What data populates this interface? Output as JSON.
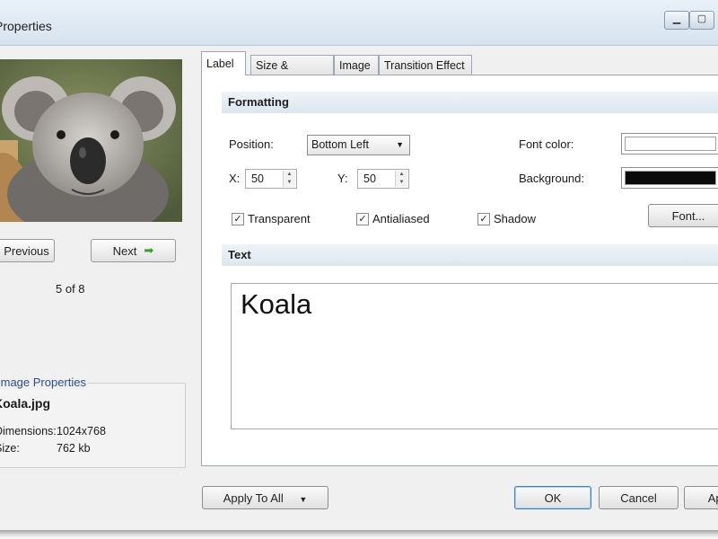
{
  "window": {
    "title": "Properties"
  },
  "preview": {
    "previous_label": "Previous",
    "next_label": "Next",
    "counter": "5 of 8"
  },
  "image_properties": {
    "legend": "Image Properties",
    "filename": "Koala.jpg",
    "rows": [
      {
        "key": "Dimensions:",
        "value": "1024x768"
      },
      {
        "key": "Size:",
        "value": "762 kb"
      }
    ]
  },
  "tabs": [
    {
      "label": "Label",
      "active": true
    },
    {
      "label": "Size & Position",
      "active": false
    },
    {
      "label": "Image",
      "active": false
    },
    {
      "label": "Transition Effect",
      "active": false
    }
  ],
  "formatting": {
    "header": "Formatting",
    "position_label": "Position:",
    "position_value": "Bottom Left",
    "x_label": "X:",
    "x_value": "50",
    "y_label": "Y:",
    "y_value": "50",
    "font_color_label": "Font color:",
    "font_color": "#ffffff",
    "background_label": "Background:",
    "background_color": "#0a0a0a",
    "checkboxes": [
      {
        "label": "Transparent",
        "checked": true
      },
      {
        "label": "Antialiased",
        "checked": true
      },
      {
        "label": "Shadow",
        "checked": true
      }
    ],
    "font_button": "Font..."
  },
  "text_section": {
    "header": "Text",
    "content": "Koala"
  },
  "footer": {
    "apply_all": "Apply To All",
    "ok": "OK",
    "cancel": "Cancel",
    "apply": "Apply"
  }
}
